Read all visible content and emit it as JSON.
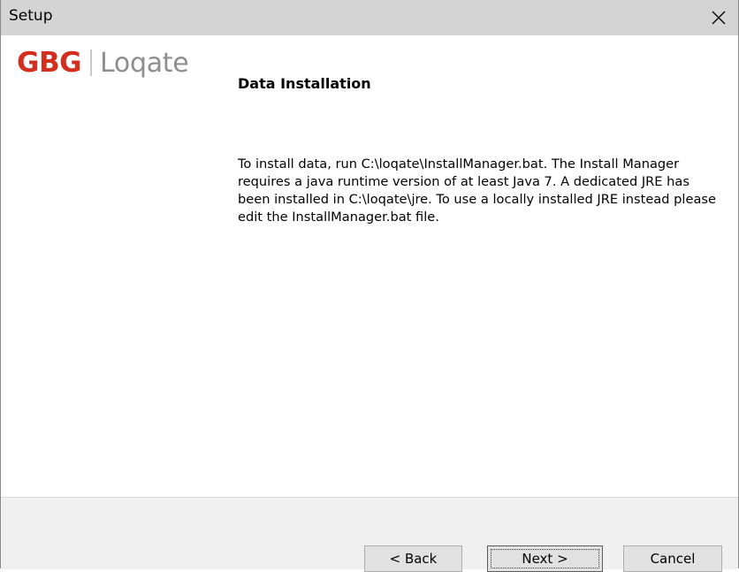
{
  "window": {
    "title": "Setup",
    "close_icon": "close-icon"
  },
  "logo": {
    "brand": "GBG",
    "product": "Loqate",
    "brand_color": "#d42e1f",
    "product_color": "#8e8e8e"
  },
  "content": {
    "heading": "Data Installation",
    "body": "To install data, run C:\\loqate\\InstallManager.bat. The Install Manager requires a java runtime version of at least Java 7. A dedicated JRE has been installed in C:\\loqate\\jre. To use a locally installed JRE instead please edit the InstallManager.bat file."
  },
  "buttons": {
    "back_label": "< Back",
    "next_label": "Next >",
    "cancel_label": "Cancel"
  }
}
